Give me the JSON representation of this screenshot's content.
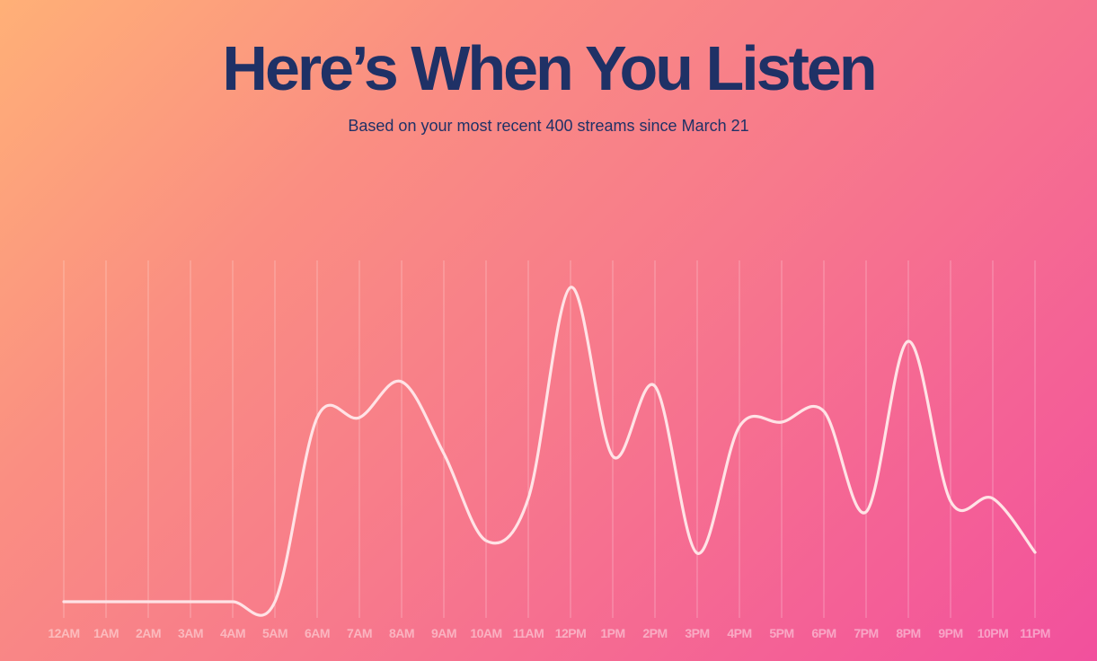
{
  "header": {
    "title": "Here’s When You Listen",
    "subtitle": "Based on your most recent 400 streams since March 21"
  },
  "colors": {
    "title": "#1f3166",
    "line": "#ffe3e6",
    "gradient_start": "#ffb077",
    "gradient_end": "#f2509d"
  },
  "chart_data": {
    "type": "line",
    "title": "",
    "xlabel": "",
    "ylabel": "",
    "grid": true,
    "categories": [
      "12AM",
      "1AM",
      "2AM",
      "3AM",
      "4AM",
      "5AM",
      "6AM",
      "7AM",
      "8AM",
      "9AM",
      "10AM",
      "11AM",
      "12PM",
      "1PM",
      "2PM",
      "3PM",
      "4PM",
      "5PM",
      "6PM",
      "7PM",
      "8PM",
      "9PM",
      "10PM",
      "11PM"
    ],
    "series": [
      {
        "values": [
          0,
          0,
          0,
          0,
          0,
          0,
          20.5,
          20.5,
          24.5,
          16.5,
          6.8,
          11.5,
          35,
          16.2,
          24,
          5.4,
          19.5,
          20,
          21.2,
          10,
          29,
          11.2,
          11.5,
          5.5
        ]
      }
    ],
    "ylim": [
      0,
      38
    ]
  }
}
